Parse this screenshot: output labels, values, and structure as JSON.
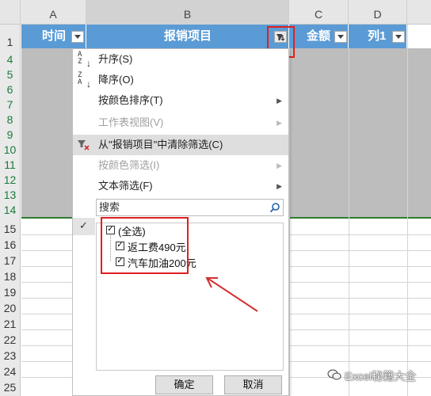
{
  "columns": [
    "A",
    "B",
    "C",
    "D"
  ],
  "rows": [
    "1",
    "4",
    "5",
    "6",
    "7",
    "8",
    "9",
    "10",
    "11",
    "12",
    "13",
    "14",
    "15",
    "16",
    "17",
    "18",
    "19",
    "20",
    "21",
    "22",
    "23",
    "24",
    "25"
  ],
  "table_headers": {
    "time": "时间",
    "item": "报销项目",
    "amount": "金额",
    "col1": "列1"
  },
  "menu": {
    "sort_asc": "升序(S)",
    "sort_desc": "降序(O)",
    "sort_by_color": "按颜色排序(T)",
    "sheet_view": "工作表视图(V)",
    "clear_filter": "从\"报销项目\"中清除筛选(C)",
    "filter_by_color": "按颜色筛选(I)",
    "text_filter": "文本筛选(F)",
    "arrow": "▶"
  },
  "sort_icons": {
    "asc_top": "A",
    "asc_bottom": "Z",
    "desc_top": "Z",
    "desc_bottom": "A"
  },
  "search": {
    "placeholder": "搜索",
    "icon": "search-icon"
  },
  "list_items": [
    "(全选)",
    "返工费490元",
    "汽车加油200元"
  ],
  "checkmark": "✓",
  "buttons": {
    "ok": "确定",
    "cancel": "取消"
  },
  "watermark": "Excel秘籍大全",
  "colors": {
    "header_blue": "#5b9bd5",
    "selection_gray": "#bdbdbd",
    "annotation_red": "#e02020"
  }
}
